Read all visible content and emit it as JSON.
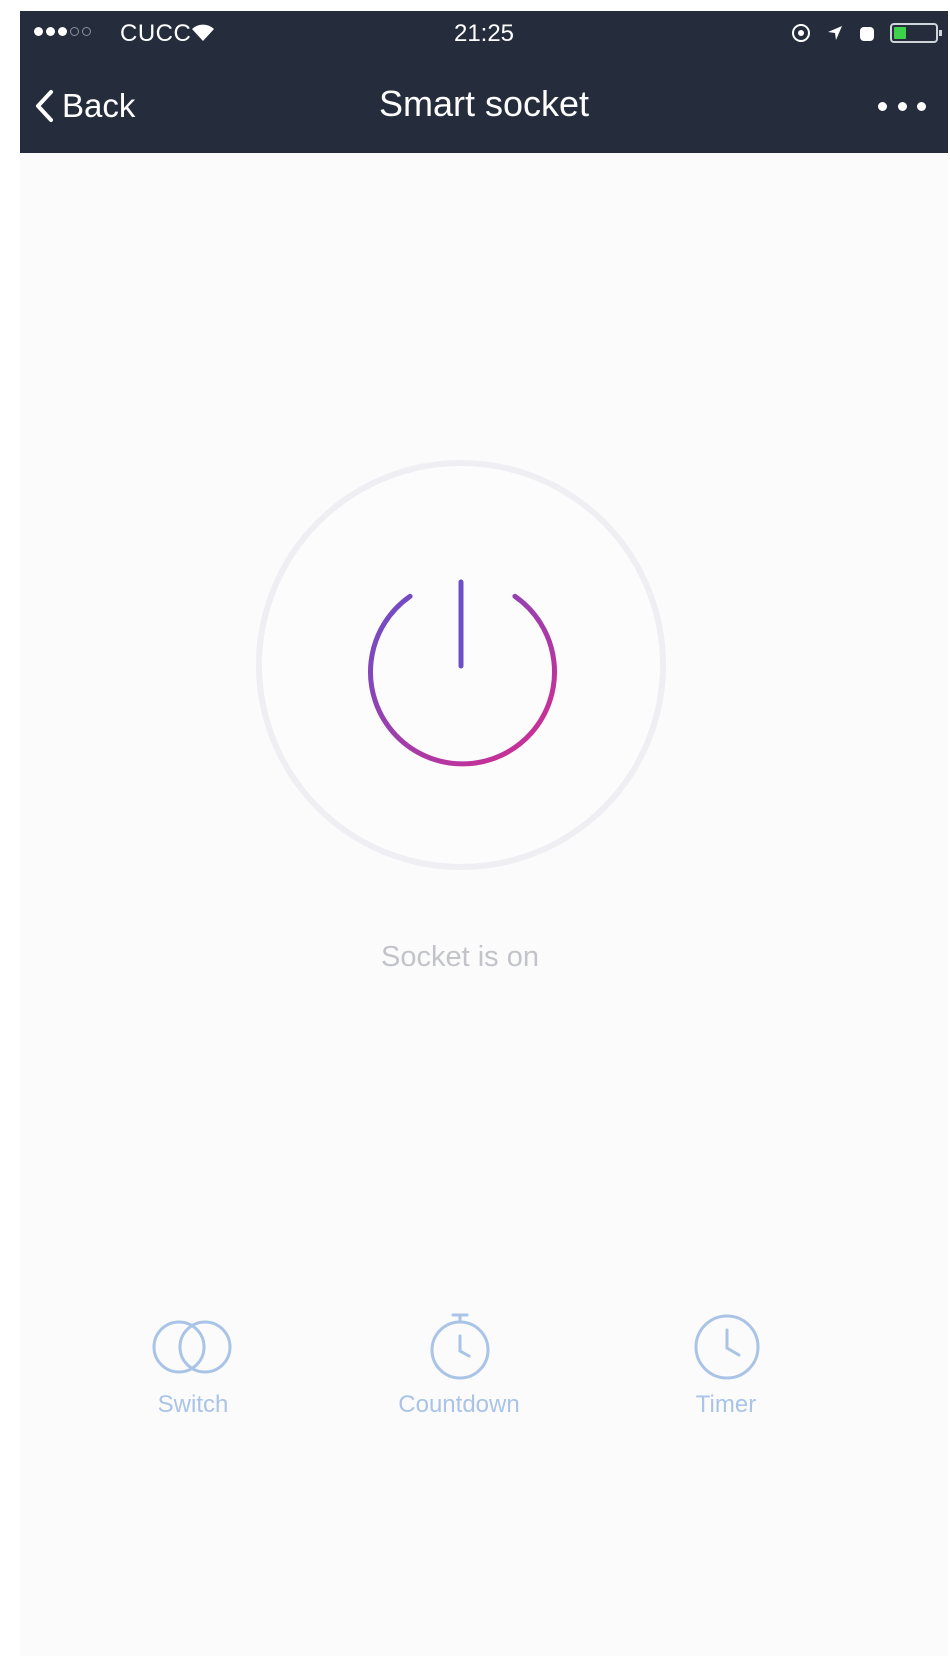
{
  "status_bar": {
    "carrier": "CUCC",
    "time": "21:25"
  },
  "nav": {
    "back_label": "Back",
    "title": "Smart socket"
  },
  "main": {
    "status_text": "Socket is on",
    "accent_colors": {
      "power_start": "#6a4fc7",
      "power_end": "#d62b8f",
      "action_blue": "#a9c4e6"
    }
  },
  "actions": [
    {
      "label": "Switch",
      "icon": "switch-icon"
    },
    {
      "label": "Countdown",
      "icon": "stopwatch-icon"
    },
    {
      "label": "Timer",
      "icon": "clock-icon"
    }
  ]
}
